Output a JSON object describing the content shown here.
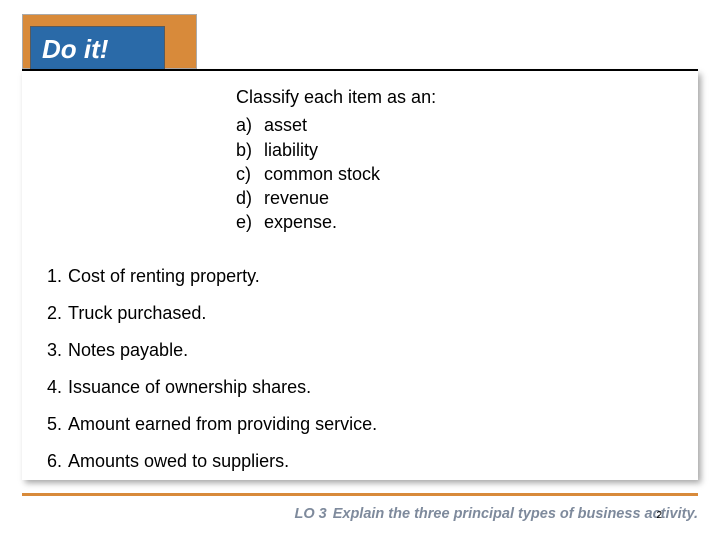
{
  "badge": {
    "label": "Do it!"
  },
  "prompt": {
    "instruction": "Classify each item as an:",
    "options": [
      {
        "letter": "a)",
        "text": "asset"
      },
      {
        "letter": "b)",
        "text": "liability"
      },
      {
        "letter": "c)",
        "text": "common stock"
      },
      {
        "letter": "d)",
        "text": "revenue"
      },
      {
        "letter": "e)",
        "text": "expense."
      }
    ]
  },
  "questions": [
    {
      "num": "1.",
      "text": "Cost of renting property."
    },
    {
      "num": "2.",
      "text": "Truck purchased."
    },
    {
      "num": "3.",
      "text": "Notes payable."
    },
    {
      "num": "4.",
      "text": "Issuance of ownership shares."
    },
    {
      "num": "5.",
      "text": "Amount earned from providing service."
    },
    {
      "num": "6.",
      "text": "Amounts owed to suppliers."
    }
  ],
  "footer": {
    "lo_label": "LO 3",
    "text": "Explain the three principal types of business activity."
  },
  "page_number": "2"
}
